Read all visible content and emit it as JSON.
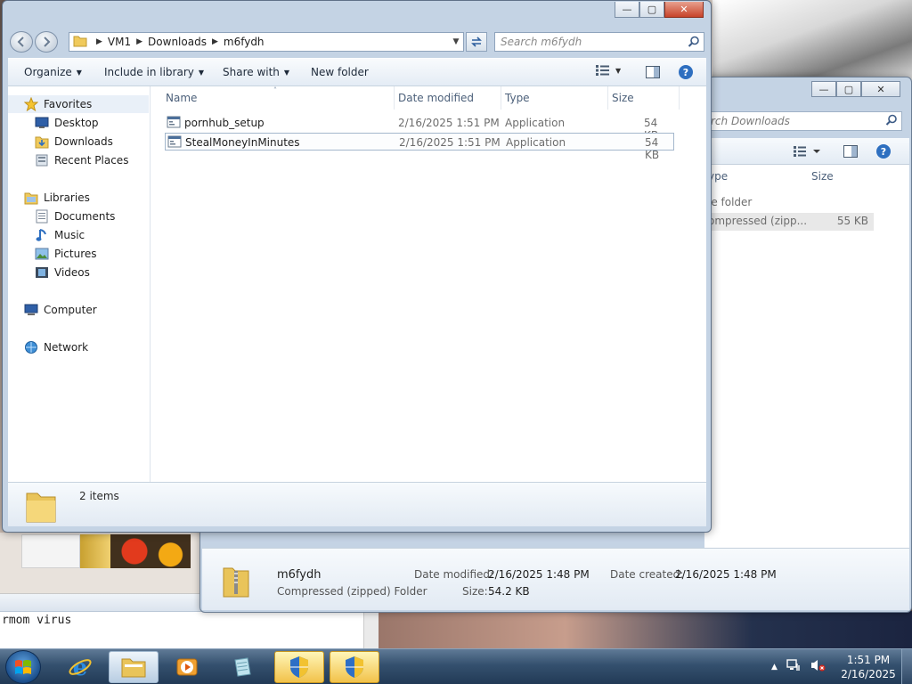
{
  "main_window": {
    "address": [
      "VM1",
      "Downloads",
      "m6fydh"
    ],
    "search_placeholder": "Search m6fydh",
    "toolbar": {
      "organize": "Organize",
      "include_in_library": "Include in library",
      "share_with": "Share with",
      "new_folder": "New folder"
    },
    "nav": {
      "favorites": "Favorites",
      "desktop": "Desktop",
      "downloads": "Downloads",
      "recent_places": "Recent Places",
      "libraries": "Libraries",
      "documents": "Documents",
      "music": "Music",
      "pictures": "Pictures",
      "videos": "Videos",
      "computer": "Computer",
      "network": "Network"
    },
    "columns": {
      "name": "Name",
      "date_modified": "Date modified",
      "type": "Type",
      "size": "Size"
    },
    "files": [
      {
        "name": "pornhub_setup",
        "date": "2/16/2025 1:51 PM",
        "type": "Application",
        "size": "54 KB"
      },
      {
        "name": "StealMoneyInMinutes",
        "date": "2/16/2025 1:51 PM",
        "type": "Application",
        "size": "54 KB"
      }
    ],
    "status": "2 items"
  },
  "back_window": {
    "search_placeholder": "rch Downloads",
    "col_type": "ype",
    "col_size": "Size",
    "row1_type": "le folder",
    "row2_type": "ompressed (zipp...",
    "row2_size": "55 KB",
    "details": {
      "name": "m6fydh",
      "kind": "Compressed (zipped) Folder",
      "date_modified_label": "Date modified:",
      "date_modified": "2/16/2025 1:48 PM",
      "size_label": "Size:",
      "size": "54.2 KB",
      "date_created_label": "Date created:",
      "date_created": "2/16/2025 1:48 PM"
    }
  },
  "notepad_text": "rmom virus",
  "clock": {
    "time": "1:51 PM",
    "date": "2/16/2025"
  }
}
